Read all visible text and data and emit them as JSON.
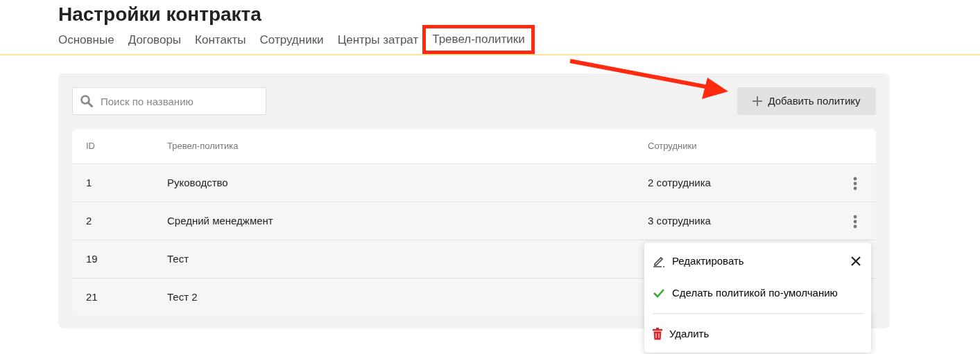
{
  "page": {
    "title": "Настройки контракта"
  },
  "tabs": [
    {
      "label": "Основные",
      "highlighted": false
    },
    {
      "label": "Договоры",
      "highlighted": false
    },
    {
      "label": "Контакты",
      "highlighted": false
    },
    {
      "label": "Сотрудники",
      "highlighted": false
    },
    {
      "label": "Центры затрат",
      "highlighted": false
    },
    {
      "label": "Тревел-политики",
      "highlighted": true
    }
  ],
  "search": {
    "placeholder": "Поиск по названию"
  },
  "add_button": {
    "label": "Добавить политику"
  },
  "table": {
    "columns": [
      "ID",
      "Тревел-политика",
      "Сотрудники"
    ],
    "rows": [
      {
        "id": "1",
        "name": "Руководство",
        "employees": "2 сотрудника",
        "menu_button": true
      },
      {
        "id": "2",
        "name": "Средний менеджмент",
        "employees": "3 сотрудника",
        "menu_button": true
      },
      {
        "id": "19",
        "name": "Тест",
        "menu_button": false
      },
      {
        "id": "21",
        "name": "Тест 2",
        "menu_button": false
      }
    ]
  },
  "context_menu": {
    "items": [
      {
        "kind": "edit",
        "label": "Редактировать"
      },
      {
        "kind": "default",
        "label": "Сделать политикой по-умолчанию"
      },
      {
        "kind": "delete",
        "label": "Удалить"
      }
    ]
  }
}
